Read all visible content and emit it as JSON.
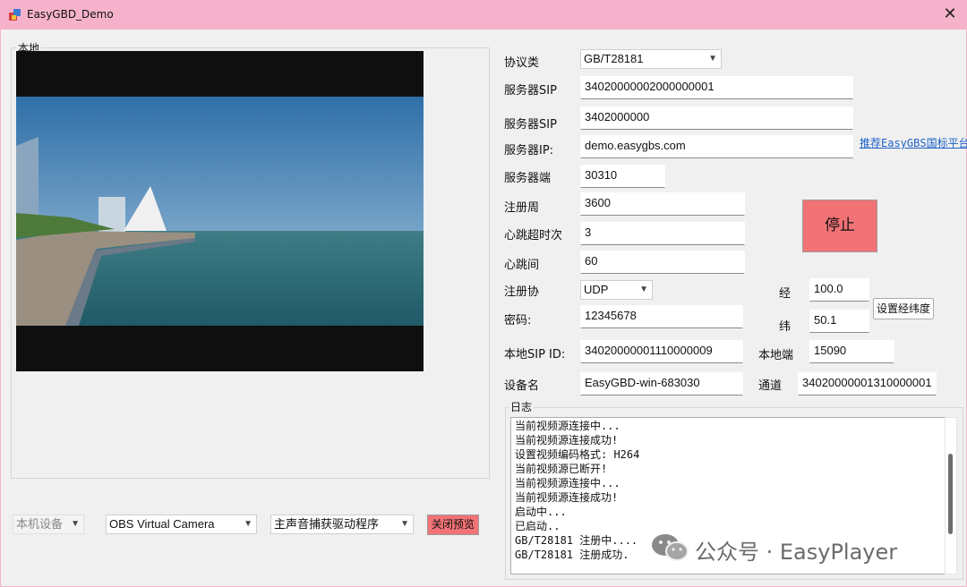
{
  "window": {
    "title": "EasyGBD_Demo",
    "close_glyph": "✕"
  },
  "preview": {
    "group_label": "本地"
  },
  "form": {
    "protocol": {
      "label": "协议类",
      "value": "GB/T28181"
    },
    "server_sip_id": {
      "label": "服务器SIP",
      "value": "34020000002000000001"
    },
    "server_sip_domain": {
      "label": "服务器SIP",
      "value": "3402000000"
    },
    "server_ip": {
      "label": "服务器IP:",
      "value": "demo.easygbs.com"
    },
    "server_port": {
      "label": "服务器端",
      "value": "30310"
    },
    "register_period": {
      "label": "注册周",
      "value": "3600"
    },
    "heartbeat_timeout": {
      "label": "心跳超时次",
      "value": "3"
    },
    "heartbeat_interval": {
      "label": "心跳间",
      "value": "60"
    },
    "register_protocol": {
      "label": "注册协",
      "value": "UDP"
    },
    "password": {
      "label": "密码:",
      "value": "12345678"
    },
    "local_sip_id": {
      "label": "本地SIP ID:",
      "value": "34020000001110000009"
    },
    "device_name": {
      "label": "设备名",
      "value": "EasyGBD-win-683030"
    },
    "longitude": {
      "label": "经",
      "value": "100.0"
    },
    "latitude": {
      "label": "纬",
      "value": "50.1"
    },
    "local_port": {
      "label": "本地端",
      "value": "15090"
    },
    "channel": {
      "label": "通道",
      "value": "34020000001310000001"
    }
  },
  "buttons": {
    "stop": "停止",
    "set_coords": "设置经纬度",
    "close_preview": "关闭预览"
  },
  "link": {
    "recommend": "推荐EasyGBS国标平台"
  },
  "devices": {
    "local_device": "本机设备",
    "camera": "OBS Virtual Camera",
    "audio": "主声音捕获驱动程序"
  },
  "log": {
    "label": "日志",
    "lines": [
      "当前视频源连接中...",
      "当前视频源连接成功!",
      "设置视频编码格式: H264",
      "当前视频源已断开!",
      "当前视频源连接中...",
      "当前视频源连接成功!",
      "启动中...",
      "已启动..",
      "GB/T28181 注册中....",
      "GB/T28181 注册成功."
    ]
  },
  "watermark": {
    "text": "公众号 · EasyPlayer"
  },
  "icons": {
    "app": "app-icon",
    "close": "close-icon",
    "dropdown": "chevron-down-icon",
    "wechat": "wechat-icon"
  }
}
